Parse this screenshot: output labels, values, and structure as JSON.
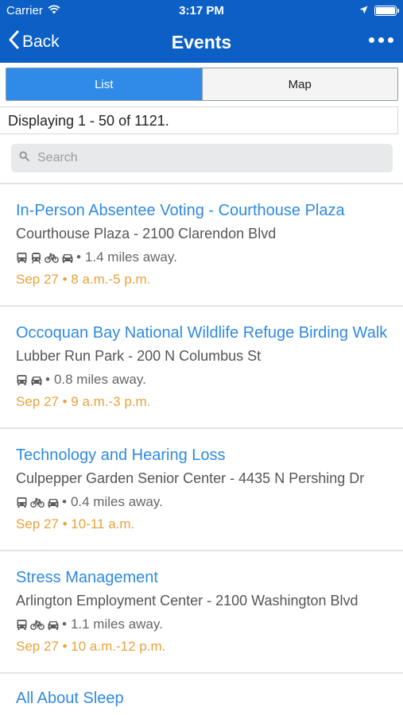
{
  "status_bar": {
    "carrier": "Carrier",
    "time": "3:17 PM"
  },
  "nav": {
    "back_label": "Back",
    "title": "Events"
  },
  "tabs": [
    {
      "label": "List",
      "active": true
    },
    {
      "label": "Map",
      "active": false
    }
  ],
  "count_text": "Displaying 1 - 50 of 1121.",
  "search": {
    "placeholder": "Search"
  },
  "events": [
    {
      "title": "In-Person Absentee Voting - Courthouse Plaza",
      "location": "Courthouse Plaza - 2100 Clarendon Blvd",
      "transport_icons": [
        "bus-icon",
        "train-icon",
        "bike-icon",
        "car-icon"
      ],
      "distance": "1.4 miles away.",
      "date": "Sep 27 • 8 a.m.-5 p.m."
    },
    {
      "title": "Occoquan Bay National Wildlife Refuge Birding Walk",
      "location": "Lubber Run Park - 200 N Columbus St",
      "transport_icons": [
        "bus-icon",
        "car-icon"
      ],
      "distance": "0.8 miles away.",
      "date": "Sep 27 • 9 a.m.-3 p.m."
    },
    {
      "title": "Technology and Hearing Loss",
      "location": "Culpepper Garden Senior Center - 4435 N Pershing Dr",
      "transport_icons": [
        "bus-icon",
        "bike-icon",
        "car-icon"
      ],
      "distance": "0.4 miles away.",
      "date": "Sep 27 • 10-11 a.m."
    },
    {
      "title": "Stress Management",
      "location": "Arlington Employment Center - 2100 Washington Blvd",
      "transport_icons": [
        "bus-icon",
        "bike-icon",
        "car-icon"
      ],
      "distance": "1.1 miles away.",
      "date": "Sep 27 • 10 a.m.-12 p.m."
    }
  ],
  "partial_event": {
    "title": "All About Sleep"
  },
  "colors": {
    "header": "#0c5fc4",
    "tab_active": "#2f8ae8",
    "link": "#2f8ae0",
    "date": "#e9a23b"
  }
}
